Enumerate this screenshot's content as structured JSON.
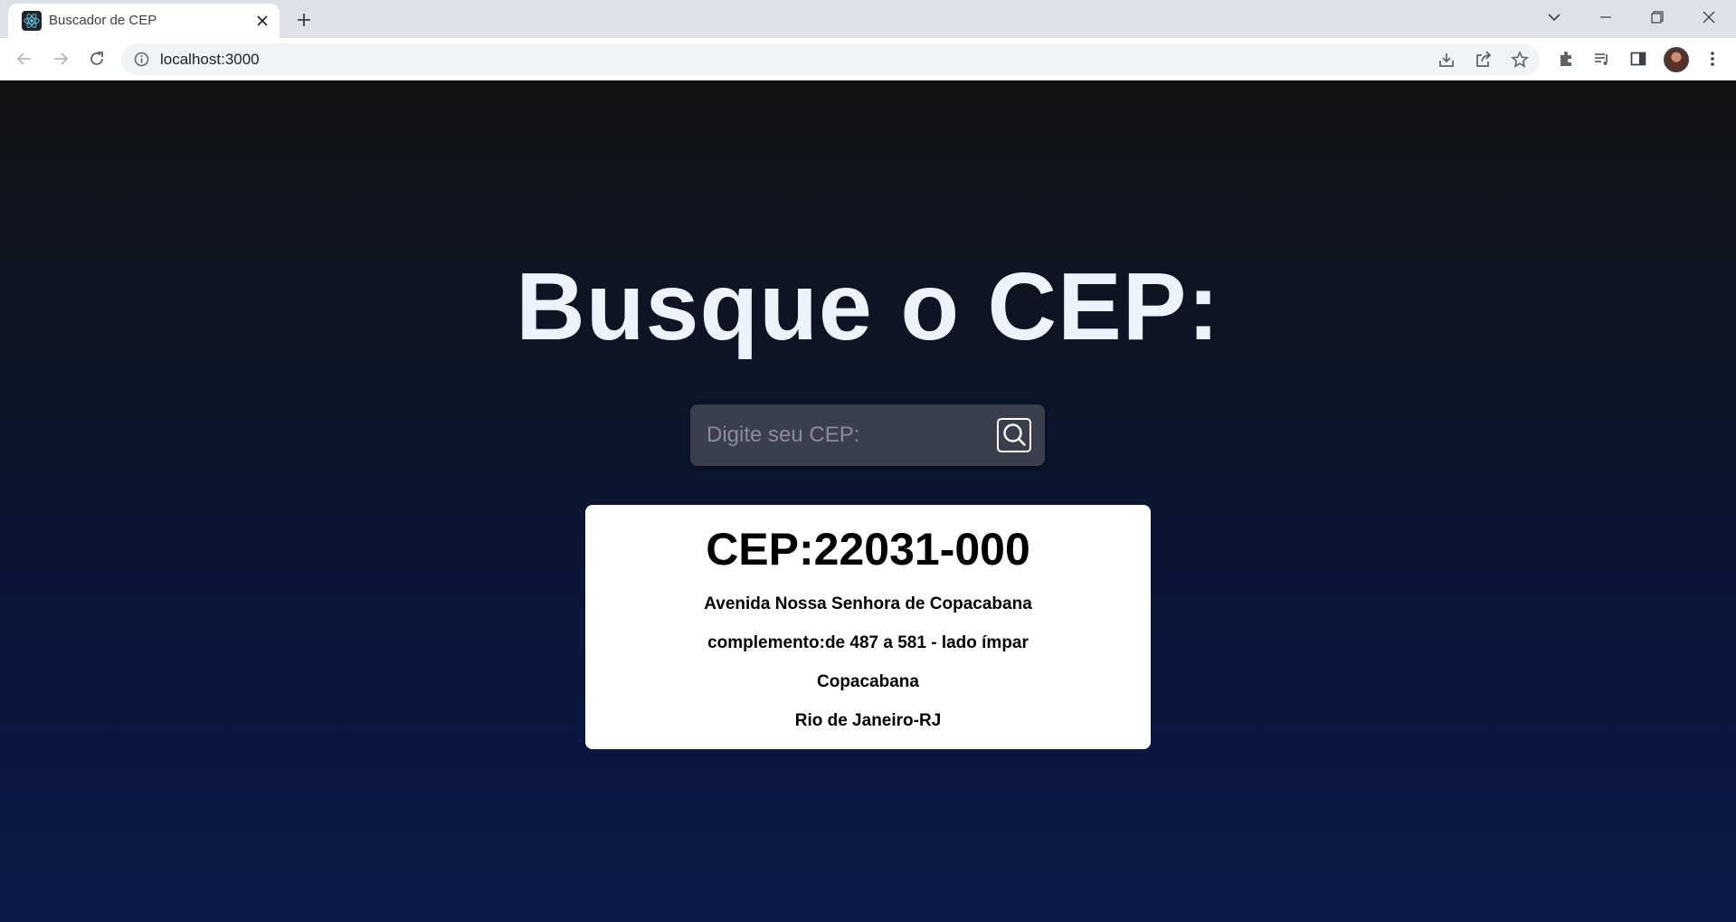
{
  "browser": {
    "tab_title": "Buscador de CEP",
    "url": "localhost:3000"
  },
  "page": {
    "headline": "Busque o CEP:",
    "search": {
      "placeholder": "Digite seu CEP:",
      "value": ""
    },
    "result": {
      "cep_label": "CEP:",
      "cep": "22031-000",
      "logradouro": "Avenida Nossa Senhora de Copacabana",
      "complemento_label": "complemento:",
      "complemento": "de 487 a 581 - lado ímpar",
      "bairro": "Copacabana",
      "localidade": "Rio de Janeiro",
      "uf": "RJ"
    }
  },
  "colors": {
    "background_top": "#121212",
    "background_bottom": "#0a1a4a",
    "headline": "#eef2fb",
    "search_box": "#3b3e4c",
    "card": "#ffffff"
  }
}
